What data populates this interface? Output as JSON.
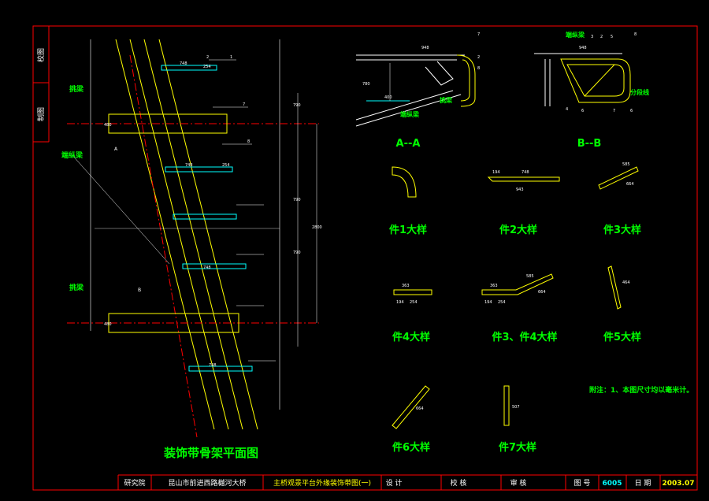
{
  "side_panel": {
    "top_label": "校图",
    "bottom_label": "制图"
  },
  "plan": {
    "title": "装饰带骨架平面图",
    "labels": {
      "beam_top": "挑梁",
      "edge_beam": "端纵梁",
      "beam_bottom": "挑梁",
      "section_a": "A",
      "section_b": "B"
    },
    "dims": {
      "d748": "748",
      "d254": "254",
      "d480": "480",
      "d790": "790",
      "d2800": "2800",
      "n1": "1",
      "n2": "2",
      "n7": "7",
      "n8": "8"
    }
  },
  "section_aa": {
    "title": "A--A",
    "labels": {
      "beam": "挑梁",
      "edge_beam": "端纵梁"
    },
    "dims": {
      "top": "948",
      "d780": "780",
      "d400": "400",
      "n7": "7",
      "n2": "2",
      "n8": "8"
    }
  },
  "section_bb": {
    "title": "B--B",
    "labels": {
      "edge_beam": "端纵梁",
      "split_line": "分段线"
    },
    "dims": {
      "top": "948",
      "nums": [
        "3",
        "2",
        "5",
        "8",
        "4",
        "6",
        "7",
        "6"
      ]
    }
  },
  "details": [
    {
      "label": "件1大样",
      "dims": []
    },
    {
      "label": "件2大样",
      "dims": [
        "194",
        "748",
        "943"
      ]
    },
    {
      "label": "件3大样",
      "dims": [
        "585",
        "664"
      ]
    },
    {
      "label": "件4大样",
      "dims": [
        "363",
        "194",
        "254"
      ]
    },
    {
      "label": "件3、件4大样",
      "dims": [
        "363",
        "194",
        "254",
        "585",
        "664"
      ]
    },
    {
      "label": "件5大样",
      "dims": [
        "464"
      ]
    },
    {
      "label": "件6大样",
      "dims": [
        "664"
      ]
    },
    {
      "label": "件7大样",
      "dims": [
        "507"
      ]
    }
  ],
  "note": "附注：1、本图尺寸均以毫米计。",
  "title_block": {
    "institute": "研究院",
    "project": "昆山市前进西路樾河大桥",
    "drawing_title": "主桥观景平台外缘装饰带图(一)",
    "design_label": "设 计",
    "check_label": "校 核",
    "review_label": "审 核",
    "number_label": "图 号",
    "number_value": "6005",
    "date_label": "日 期",
    "date_value": "2003.07"
  },
  "colors": {
    "border": "#ff0000",
    "text_green": "#00ff00",
    "line_yellow": "#ffff00",
    "line_green": "#00ff00",
    "line_cyan": "#00ffff"
  }
}
